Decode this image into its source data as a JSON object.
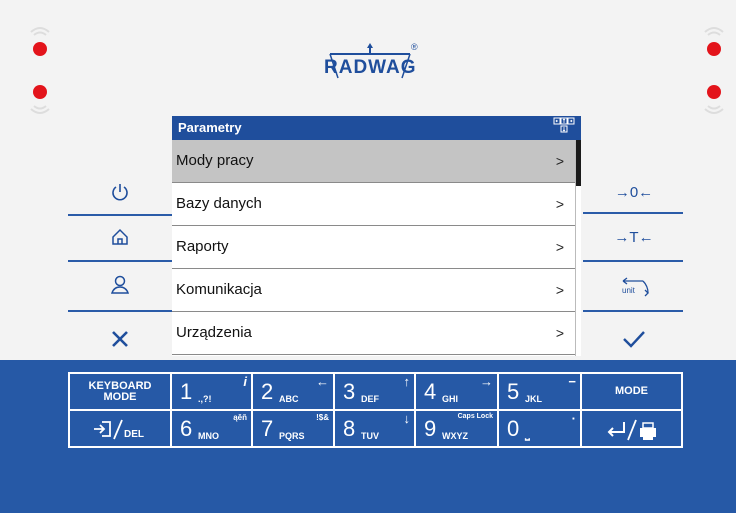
{
  "brand": {
    "logo_text": "RADWAG",
    "registered": "®"
  },
  "colors": {
    "accent": "#1f4e9c",
    "keyboard": "#2659a6",
    "led": "#e3141b",
    "selected_row": "#c4c4c4"
  },
  "screen": {
    "title": "Parametry",
    "nav_icon": "arrows-nav-icon",
    "menu": [
      {
        "label": "Mody pracy",
        "arrow": ">",
        "selected": true
      },
      {
        "label": "Bazy danych",
        "arrow": ">"
      },
      {
        "label": "Raporty",
        "arrow": ">"
      },
      {
        "label": "Komunikacja",
        "arrow": ">"
      },
      {
        "label": "Urządzenia",
        "arrow": ">"
      }
    ]
  },
  "left_buttons": [
    "power-icon",
    "home-icon",
    "user-icon",
    "close-icon"
  ],
  "right_buttons": {
    "zero": "→0←",
    "tare": "→T←",
    "unit_label": "unit",
    "confirm": "check-icon"
  },
  "keyboard": {
    "keyboard_mode": "KEYBOARD\nMODE",
    "mode": "MODE",
    "del": "DEL",
    "keys_row1": [
      {
        "digit": "1",
        "sub": ".,?!",
        "hint": "i"
      },
      {
        "digit": "2",
        "sub": "ABC",
        "hint": "←"
      },
      {
        "digit": "3",
        "sub": "DEF",
        "hint": "↑"
      },
      {
        "digit": "4",
        "sub": "GHI",
        "hint": "→"
      },
      {
        "digit": "5",
        "sub": "JKL",
        "hint": "−"
      }
    ],
    "keys_row2": [
      {
        "digit": "6",
        "sub": "MNO",
        "hint": "ąěň"
      },
      {
        "digit": "7",
        "sub": "PQRS",
        "hint": "!$&"
      },
      {
        "digit": "8",
        "sub": "TUV",
        "hint": "↓"
      },
      {
        "digit": "9",
        "sub": "WXYZ",
        "hint": "Caps Lock"
      },
      {
        "digit": "0",
        "sub": "⎵",
        "hint": "·"
      }
    ]
  }
}
